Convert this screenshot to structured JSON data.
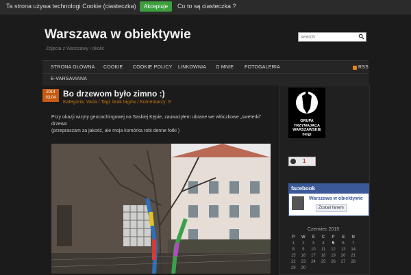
{
  "cookie_bar": {
    "text": "Ta strona używa technologi Cookie (ciasteczka)",
    "accept_label": "Akceptuje",
    "more_label": "Co to są ciasteczka ?"
  },
  "header": {
    "title": "Warszawa w obiektywie",
    "tagline": "Zdjęcia z Warszawy i okolic",
    "search_placeholder": "search"
  },
  "nav": {
    "items": [
      "STRONA GŁÓWNA",
      "COOKIE",
      "COOKIE POLICY",
      "LINKOWNIA",
      "O MNIE",
      "FOTOGALERIA"
    ],
    "second_row": [
      "E-VARSAVIANA"
    ],
    "rss_label": "RSS"
  },
  "post": {
    "date_year": "2014",
    "date_day": "03.04",
    "title": "Bo drzewom było zimno :)",
    "meta": "Kategoria: Varia / Tagi: brak tagów / Komentarzy: 9",
    "body_line1": "Przy okazji wizyty geocachingowej na Saskiej Kępie, zauważyłem ubrane we włóczkowe „sweterki” drzewa",
    "body_line2": "(przepraszam za jakość, ale moja komórka robi denne fotki )"
  },
  "sidebar": {
    "logo_lines": [
      "GRUPA",
      "TRZYMAJĄCA",
      "WARSZAWSKIE",
      "blogi"
    ],
    "counter_value": "1",
    "facebook": {
      "header": "facebook",
      "page_name": "Warszawa w obiektywie",
      "like_label": "Zostań fanem"
    },
    "calendar": {
      "caption": "Czerwiec 2015",
      "weekdays": [
        "P",
        "W",
        "Ś",
        "C",
        "P",
        "S",
        "N"
      ],
      "weeks": [
        [
          "1",
          "2",
          "3",
          "4",
          "5",
          "6",
          "7"
        ],
        [
          "8",
          "9",
          "10",
          "11",
          "12",
          "13",
          "14"
        ],
        [
          "15",
          "16",
          "17",
          "18",
          "19",
          "20",
          "21"
        ],
        [
          "22",
          "23",
          "24",
          "25",
          "26",
          "27",
          "28"
        ],
        [
          "29",
          "30",
          "",
          "",
          "",
          "",
          ""
        ]
      ]
    }
  },
  "colors": {
    "accent": "#c8760f",
    "accept_button": "#3d9e3d",
    "facebook_blue": "#3b5998"
  }
}
